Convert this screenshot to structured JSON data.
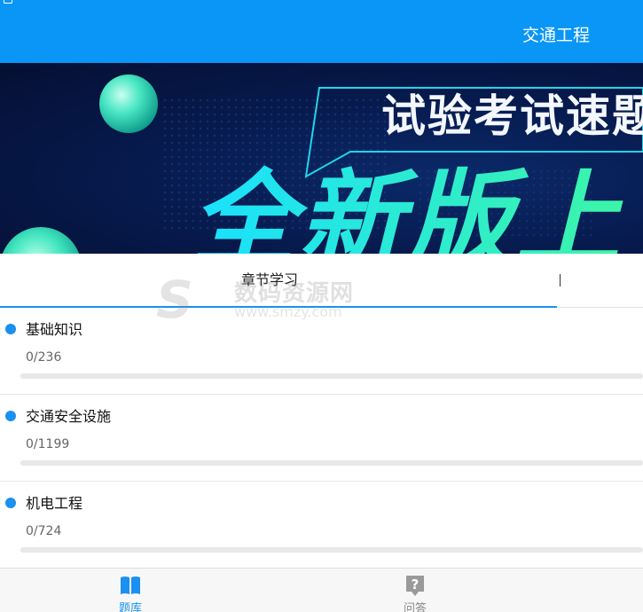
{
  "header": {
    "title": "交通工程"
  },
  "banner": {
    "headline": "试验考试速题",
    "big_text": "全新版上"
  },
  "tabs": {
    "current_label": "章节学习"
  },
  "watermark": {
    "cn": "数码资源网",
    "en": "www.smzy.com"
  },
  "categories": [
    {
      "title": "基础知识",
      "count_text": "0/236",
      "progress": 0
    },
    {
      "title": "交通安全设施",
      "count_text": "0/1199",
      "progress": 0
    },
    {
      "title": "机电工程",
      "count_text": "0/724",
      "progress": 0
    }
  ],
  "bottom_nav": [
    {
      "label": "题库",
      "icon": "book-icon",
      "active": true
    },
    {
      "label": "问答",
      "icon": "question-icon",
      "active": false
    }
  ],
  "colors": {
    "primary": "#0a96f6",
    "accent": "#1a90f0",
    "banner_bg": "#071b4f",
    "banner_glow": "#19e0ff"
  }
}
